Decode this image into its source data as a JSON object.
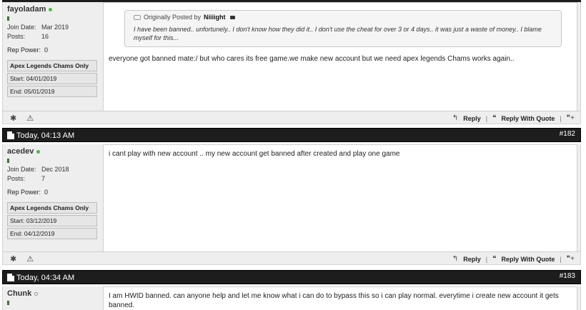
{
  "posts": [
    {
      "author": "fayoladam",
      "online": true,
      "join_date_label": "Join Date:",
      "join_date": "Mar 2019",
      "posts_label": "Posts:",
      "posts": "16",
      "rep_power_label": "Rep Power:",
      "rep_power": "0",
      "subscription": "Apex Legends Chams Only",
      "start_label": "Start:",
      "start": "04/01/2019",
      "end_label": "End:",
      "end": "05/01/2019",
      "quote": {
        "prefix": "Originally Posted by",
        "author": "Niiiight",
        "text": "I have been banned.. unfortunely.. I don't know how they did it.. I don't use the cheat for over 3 or 4 days.. it was just a waste of money.. I blame myself for this..."
      },
      "message": "everyone got banned mate:/ but who cares its free game.we make new account but we need apex legends Chams works again.."
    },
    {
      "date": "Today, 04:13 AM",
      "number": "#182",
      "author": "acedev",
      "online": true,
      "join_date_label": "Join Date:",
      "join_date": "Dec 2018",
      "posts_label": "Posts:",
      "posts": "7",
      "rep_power_label": "Rep Power:",
      "rep_power": "0",
      "subscription": "Apex Legends Chams Only",
      "start_label": "Start:",
      "start": "03/12/2019",
      "end_label": "End:",
      "end": "04/12/2019",
      "message": "i cant play with new account .. my new account get banned after created and play one game"
    },
    {
      "date": "Today, 04:34 AM",
      "number": "#183",
      "author": "Chunk",
      "online": false,
      "message": "I am HWID banned. can anyone help and let me know what i can do to bypass this so i can play normal. everytime i create new account it gets banned."
    }
  ],
  "footer": {
    "reply_label": "Reply",
    "reply_with_quote_label": "Reply With Quote"
  }
}
